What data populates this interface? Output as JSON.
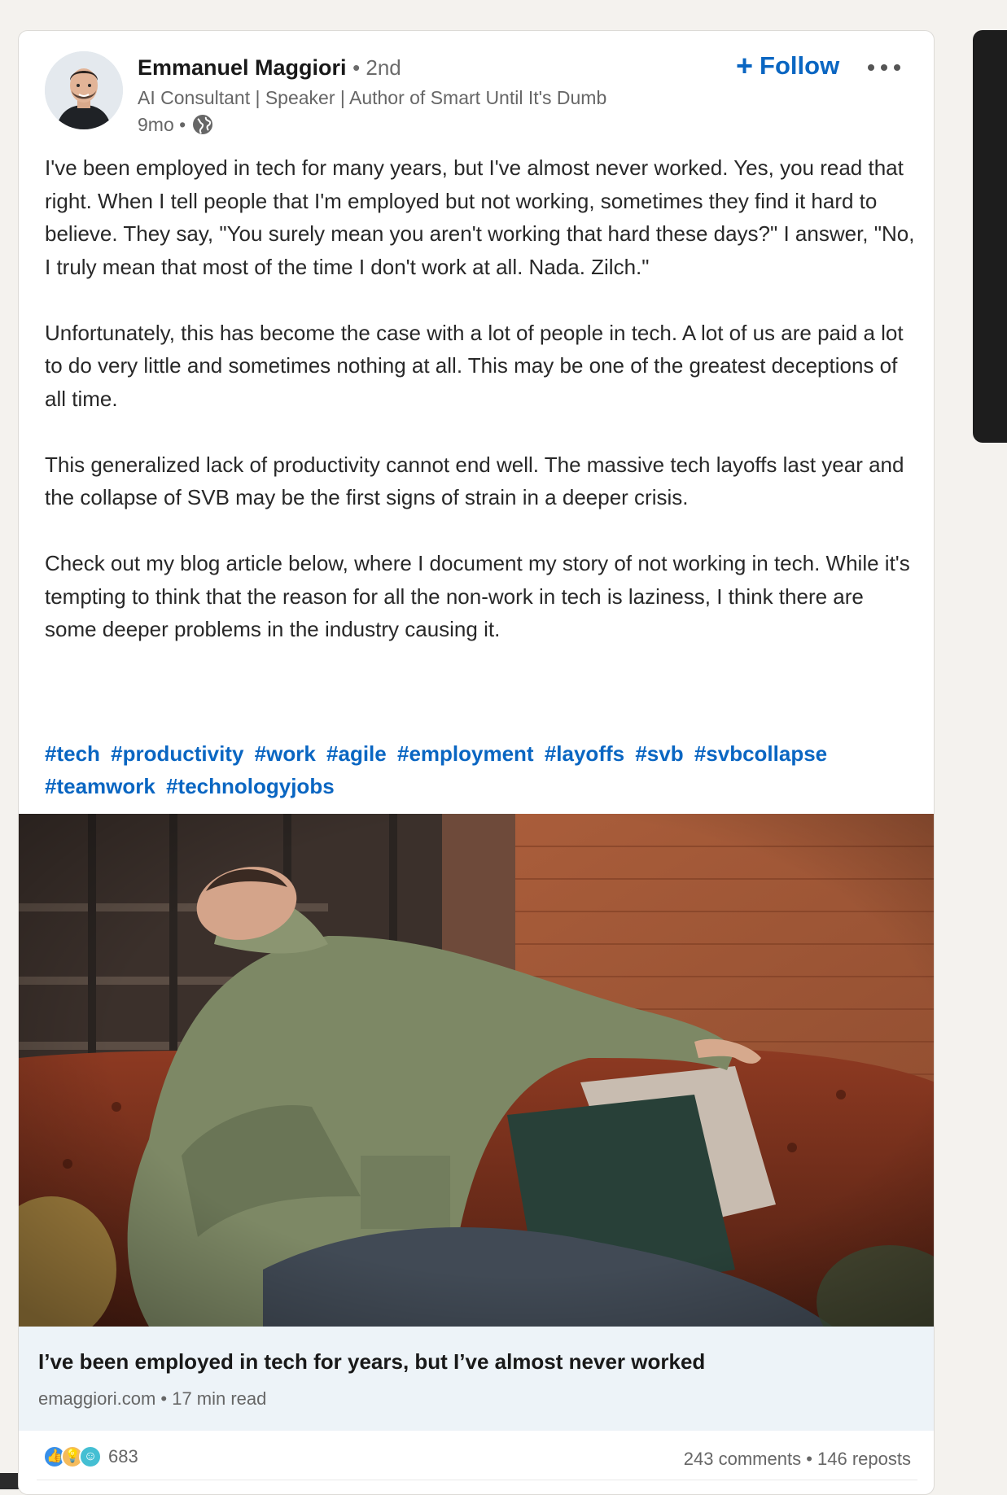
{
  "author": {
    "name": "Emmanuel Maggiori",
    "degree": "• 2nd",
    "headline": "AI Consultant | Speaker | Author of Smart Until It's Dumb",
    "posted": "9mo •",
    "visibility_icon": "globe-icon"
  },
  "actions": {
    "follow_label": "Follow",
    "follow_icon": "plus-icon",
    "more_icon": "more-horizontal-icon"
  },
  "post": {
    "paragraphs": [
      "I've been employed in tech for many years, but I've almost never worked. Yes, you read that right. When I tell people that I'm employed but not working, sometimes they find it hard to believe. They say, \"You surely mean you aren't working that hard these days?\" I answer, \"No, I truly mean that most of the time I don't work at all. Nada. Zilch.\"",
      "Unfortunately, this has become the case with a lot of people in tech. A lot of us are paid a lot to do very little and sometimes nothing at all. This may be one of the greatest deceptions of all time.",
      "This generalized lack of productivity cannot end well. The massive tech layoffs last year and the collapse of SVB may be the first signs of strain in a deeper crisis.",
      "Check out my blog article below, where I document my story of not working in tech. While it's tempting to think that the reason for all the non-work in tech is laziness, I think there are some deeper problems in the industry causing it."
    ],
    "hashtags": [
      "#tech",
      "#productivity",
      "#work",
      "#agile",
      "#employment",
      "#layoffs",
      "#svb",
      "#svbcollapse",
      "#teamwork",
      "#technologyjobs"
    ]
  },
  "link_preview": {
    "title": "I’ve been employed in tech for years, but I’ve almost never worked",
    "meta": "emaggiori.com • 17 min read"
  },
  "social": {
    "reaction_icons": [
      "like-icon",
      "insightful-icon",
      "funny-icon"
    ],
    "reaction_count": "683",
    "comments": "243 comments",
    "separator": " • ",
    "reposts": "146 reposts"
  },
  "colors": {
    "accent": "#0a66c2",
    "page_bg": "#f4f2ee",
    "card_bg": "#ffffff",
    "preview_bg": "#edf3f8"
  }
}
